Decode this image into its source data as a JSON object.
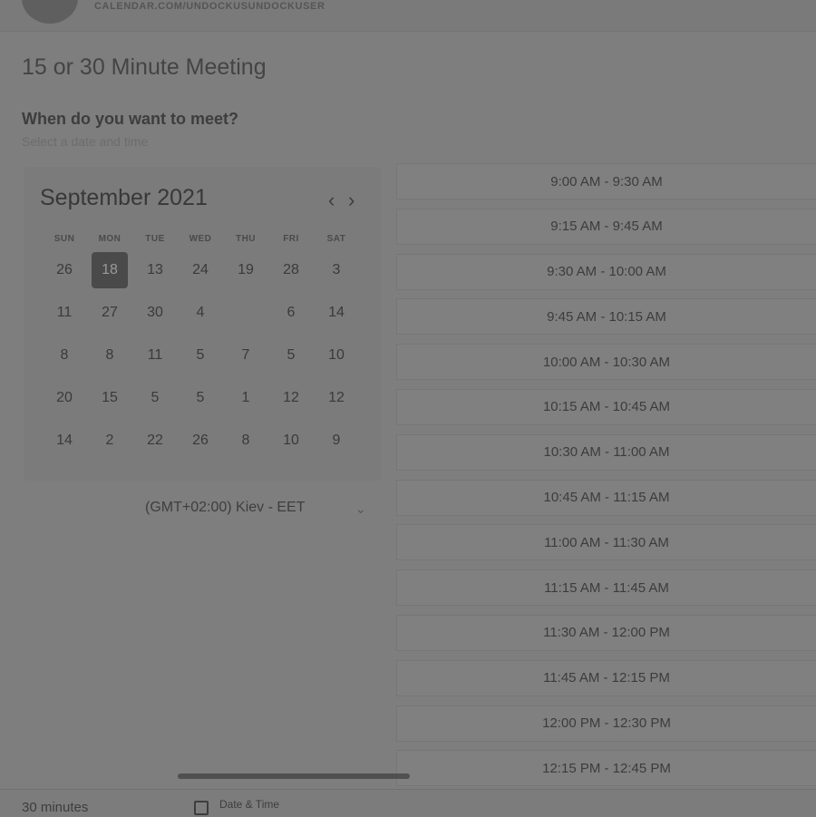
{
  "header": {
    "url": "CALENDAR.COM/UNDOCKUSUNDOCKUSER"
  },
  "meeting": {
    "title": "15 or 30 Minute Meeting",
    "question": "When do you want to meet?",
    "hint": "Select a date and time"
  },
  "calendar": {
    "month_label": "September 2021",
    "prev_icon": "chevron-left-icon",
    "next_icon": "chevron-right-icon",
    "weekdays": [
      "SUN",
      "MON",
      "TUE",
      "WED",
      "THU",
      "FRI",
      "SAT"
    ],
    "weeks": [
      [
        {
          "label": "26",
          "selected": false
        },
        {
          "label": "18",
          "selected": true
        },
        {
          "label": "13",
          "selected": false
        },
        {
          "label": "24",
          "selected": false
        },
        {
          "label": "19",
          "selected": false
        },
        {
          "label": "28",
          "selected": false
        },
        {
          "label": "3",
          "selected": false
        }
      ],
      [
        {
          "label": "11",
          "selected": false
        },
        {
          "label": "27",
          "selected": false
        },
        {
          "label": "30",
          "selected": false
        },
        {
          "label": "4",
          "selected": false
        },
        {
          "label": "",
          "selected": false
        },
        {
          "label": "6",
          "selected": false
        },
        {
          "label": "14",
          "selected": false
        }
      ],
      [
        {
          "label": "8",
          "selected": false
        },
        {
          "label": "8",
          "selected": false
        },
        {
          "label": "11",
          "selected": false
        },
        {
          "label": "5",
          "selected": false
        },
        {
          "label": "7",
          "selected": false
        },
        {
          "label": "5",
          "selected": false
        },
        {
          "label": "10",
          "selected": false
        }
      ],
      [
        {
          "label": "20",
          "selected": false
        },
        {
          "label": "15",
          "selected": false
        },
        {
          "label": "5",
          "selected": false
        },
        {
          "label": "5",
          "selected": false
        },
        {
          "label": "1",
          "selected": false
        },
        {
          "label": "12",
          "selected": false
        },
        {
          "label": "12",
          "selected": false
        }
      ],
      [
        {
          "label": "14",
          "selected": false
        },
        {
          "label": "2",
          "selected": false
        },
        {
          "label": "22",
          "selected": false
        },
        {
          "label": "26",
          "selected": false
        },
        {
          "label": "8",
          "selected": false
        },
        {
          "label": "10",
          "selected": false
        },
        {
          "label": "9",
          "selected": false
        }
      ]
    ]
  },
  "timezone": {
    "label": "(GMT+02:00) Kiev - EET",
    "icon": "chevron-down-icon"
  },
  "time_slots": [
    "9:00 AM - 9:30 AM",
    "9:15 AM - 9:45 AM",
    "9:30 AM - 10:00 AM",
    "9:45 AM - 10:15 AM",
    "10:00 AM - 10:30 AM",
    "10:15 AM - 10:45 AM",
    "10:30 AM - 11:00 AM",
    "10:45 AM - 11:15 AM",
    "11:00 AM - 11:30 AM",
    "11:15 AM - 11:45 AM",
    "11:30 AM - 12:00 PM",
    "11:45 AM - 12:15 PM",
    "12:00 PM - 12:30 PM",
    "12:15 PM - 12:45 PM"
  ],
  "footer": {
    "duration": "30 minutes",
    "date_time_label": "Date & Time",
    "date_time_icon": "calendar-icon"
  }
}
